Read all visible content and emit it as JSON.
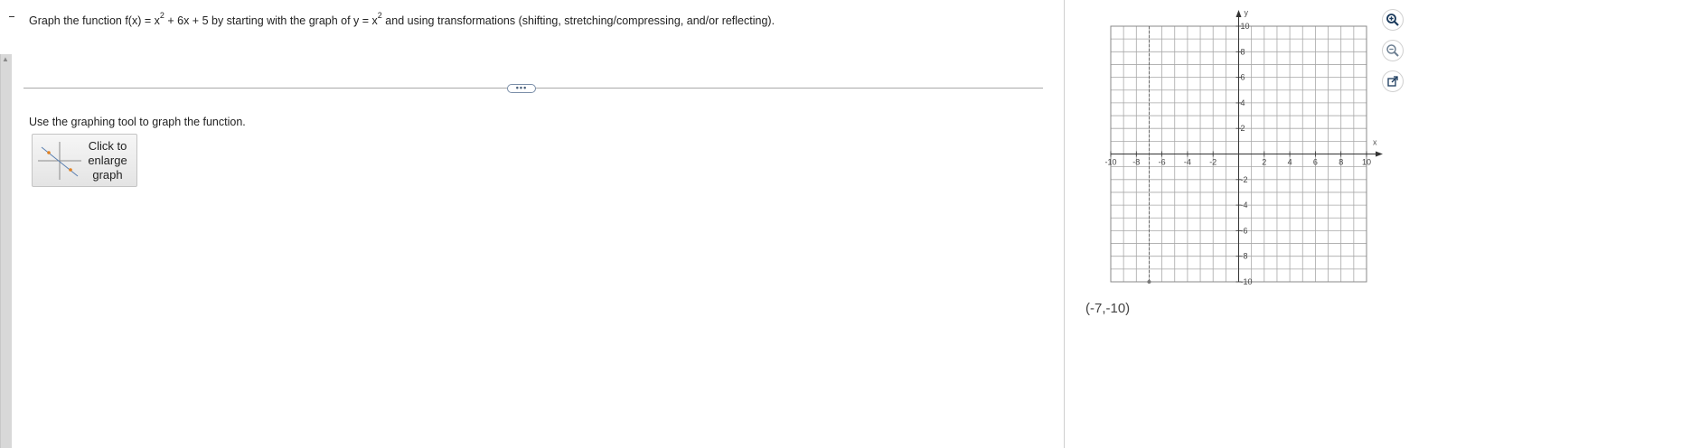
{
  "question": {
    "part1": "Graph the function f(x) = x",
    "sup1": "2",
    "part2": " + 6x + 5 by starting with the graph of y = x",
    "sup2": "2",
    "part3": " and using transformations (shifting, stretching/compressing, and/or reflecting)."
  },
  "divider": {
    "handle_label": "•••"
  },
  "instruction": "Use the graphing tool to graph the function.",
  "enlarge_button": {
    "line1": "Click to",
    "line2": "enlarge",
    "line3": "graph"
  },
  "graph": {
    "x_axis_label": "x",
    "y_axis_label": "y",
    "x_range": [
      -10,
      10
    ],
    "y_range": [
      -10,
      10
    ],
    "grid_step": 1,
    "grid": true,
    "x_tick_labels": [
      "-10",
      "-8",
      "-6",
      "-4",
      "-2",
      "2",
      "4",
      "6",
      "8",
      "10"
    ],
    "y_tick_labels": [
      "10",
      "8",
      "6",
      "4",
      "2",
      "-2",
      "-4",
      "-6",
      "-8",
      "-10"
    ],
    "cursor": {
      "x": -7,
      "y": -10
    },
    "cursor_readout": "(-7,-10)",
    "colors": {
      "grid": "#a8a8a8",
      "axis": "#333333",
      "cursor_guide": "#555555"
    }
  },
  "toolbar": {
    "zoom_in_icon": "zoom-in-icon",
    "zoom_out_icon": "zoom-out-icon",
    "popout_icon": "popout-icon"
  }
}
